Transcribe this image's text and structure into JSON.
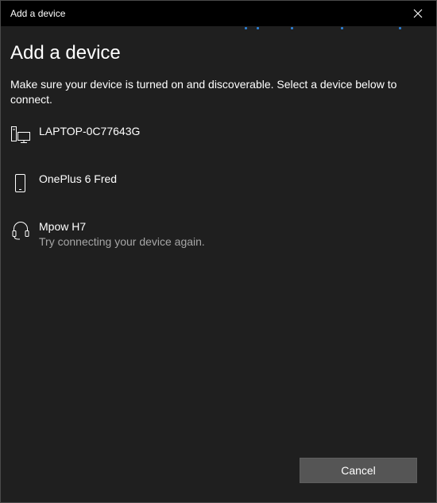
{
  "window": {
    "title": "Add a device"
  },
  "header": {
    "heading": "Add a device",
    "instructions": "Make sure your device is turned on and discoverable. Select a device below to connect."
  },
  "devices": [
    {
      "name": "LAPTOP-0C77643G",
      "icon": "computer-icon",
      "status": ""
    },
    {
      "name": "OnePlus 6 Fred",
      "icon": "phone-icon",
      "status": ""
    },
    {
      "name": "Mpow H7",
      "icon": "headset-icon",
      "status": "Try connecting your device again."
    }
  ],
  "footer": {
    "cancel_label": "Cancel"
  },
  "colors": {
    "titlebar_bg": "#000000",
    "window_bg": "#1f1f1f",
    "accent": "#2d7fd3",
    "button_bg": "#555555",
    "secondary_text": "#a6a6a6"
  }
}
